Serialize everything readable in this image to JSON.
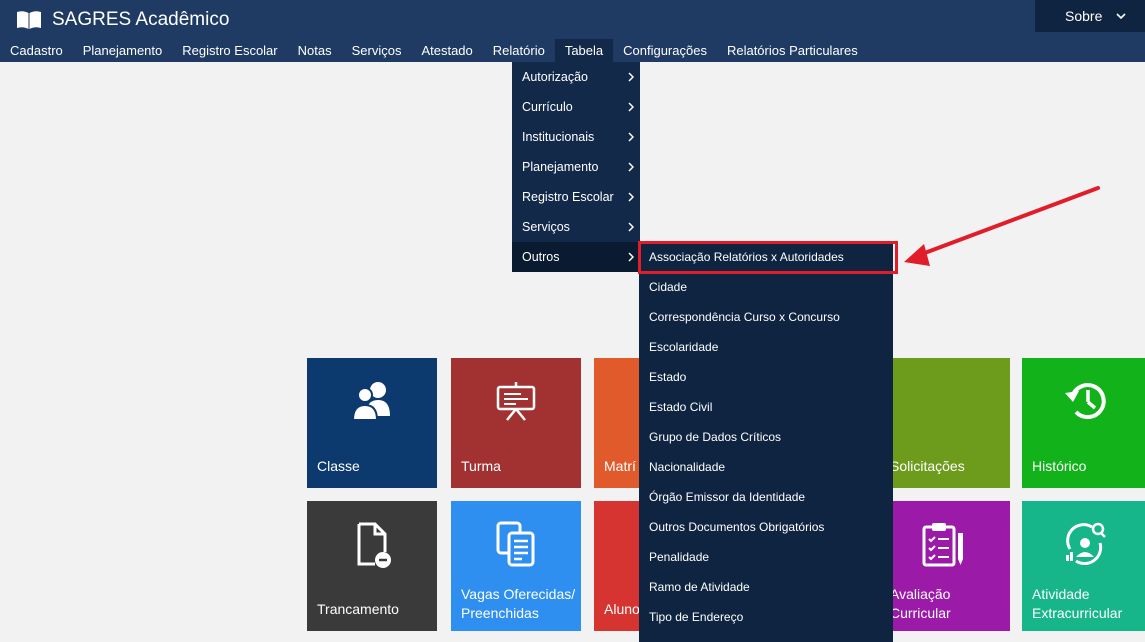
{
  "app": {
    "title": "SAGRES Acadêmico"
  },
  "header": {
    "sobre_label": "Sobre"
  },
  "menubar": {
    "items": [
      {
        "label": "Cadastro"
      },
      {
        "label": "Planejamento"
      },
      {
        "label": "Registro Escolar"
      },
      {
        "label": "Notas"
      },
      {
        "label": "Serviços"
      },
      {
        "label": "Atestado"
      },
      {
        "label": "Relatório"
      },
      {
        "label": "Tabela"
      },
      {
        "label": "Configurações"
      },
      {
        "label": "Relatórios Particulares"
      }
    ]
  },
  "dropdown": {
    "items": [
      {
        "label": "Autorização"
      },
      {
        "label": "Currículo"
      },
      {
        "label": "Institucionais"
      },
      {
        "label": "Planejamento"
      },
      {
        "label": "Registro Escolar"
      },
      {
        "label": "Serviços"
      },
      {
        "label": "Outros"
      }
    ]
  },
  "submenu": {
    "items": [
      {
        "label": "Associação Relatórios x Autoridades"
      },
      {
        "label": "Cidade"
      },
      {
        "label": "Correspondência Curso x Concurso"
      },
      {
        "label": "Escolaridade"
      },
      {
        "label": "Estado"
      },
      {
        "label": "Estado Civil"
      },
      {
        "label": "Grupo de Dados Críticos"
      },
      {
        "label": "Nacionalidade"
      },
      {
        "label": "Órgão Emissor da Identidade"
      },
      {
        "label": "Outros Documentos Obrigatórios"
      },
      {
        "label": "Penalidade"
      },
      {
        "label": "Ramo de Atividade"
      },
      {
        "label": "Tipo de Endereço"
      }
    ]
  },
  "tiles": {
    "classe": "Classe",
    "turma": "Turma",
    "matricula": "Matrí",
    "solicitacoes": "Solicitações",
    "historico": "Histórico",
    "trancamento": "Trancamento",
    "vagas": "Vagas Oferecidas/ Preenchidas",
    "aluno": "Aluno",
    "avaliacao": "Avaliação Curricular",
    "atividade": "Atividade Extracurricular"
  },
  "colors": {
    "header": "#1f3b63",
    "highlight": "#e11d2a",
    "classe": "#0d3a6e",
    "turma": "#a23232",
    "matricula": "#e05a2b",
    "solicitacoes": "#6d9b1c",
    "historico": "#12b21a",
    "trancamento": "#3a3a3a",
    "vagas": "#2e8ff0",
    "aluno": "#d63431",
    "avaliacao": "#9b1aa8",
    "atividade": "#17b58a"
  }
}
